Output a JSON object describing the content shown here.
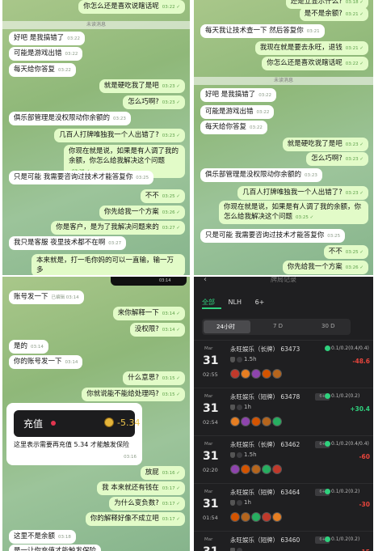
{
  "panel1": {
    "messages": [
      {
        "text": "你怎么还是喜欢说瞎话呢",
        "time": "03:22",
        "dir": "out"
      },
      {
        "divider": "未读消息"
      },
      {
        "text": "好吧 是我搞错了",
        "time": "03:22",
        "dir": "in"
      },
      {
        "text": "可能是游戏出错",
        "time": "03:22",
        "dir": "in"
      },
      {
        "text": "每天给你答复",
        "time": "03:22",
        "dir": "in"
      },
      {
        "text": "就是硬吃我了是吧",
        "time": "03:23",
        "dir": "out"
      },
      {
        "text": "怎么巧啊?",
        "time": "03:23",
        "dir": "out"
      },
      {
        "text": "俱乐部管理是没权限动你余额的",
        "time": "03:23",
        "dir": "in"
      },
      {
        "text": "几百人打牌唯独我一个人出错了?",
        "time": "03:23",
        "dir": "out"
      },
      {
        "text": "你现在就是说，如果是有人调了我的余额，你怎么给我解决这个问题",
        "time": "03:25",
        "dir": "out"
      },
      {
        "text": "只是可能  我需要咨询过技术才能答复你",
        "time": "03:25",
        "dir": "in"
      },
      {
        "text": "不不",
        "time": "03:25",
        "dir": "out"
      },
      {
        "text": "你先给我一个方案",
        "time": "03:26",
        "dir": "out"
      },
      {
        "text": "你是客户，是为了我解决问题来的",
        "time": "03:27",
        "dir": "out"
      },
      {
        "text": "我只是客服 夜里技术都不在啊",
        "time": "03:27",
        "dir": "in"
      },
      {
        "text": "本来就是，打一毛你妈的可以一直输，输一万多",
        "time": "",
        "dir": "out"
      }
    ]
  },
  "panel2": {
    "messages": [
      {
        "text": "还是立显示什么?",
        "time": "03:18",
        "dir": "out"
      },
      {
        "text": "是不是余额?",
        "time": "03:21",
        "dir": "out"
      },
      {
        "text": "每天我让技术查一下 然后答复你",
        "time": "03:21",
        "dir": "in"
      },
      {
        "text": "我现在就是要去永旺，退钱",
        "time": "03:21",
        "dir": "out"
      },
      {
        "text": "你怎么还是喜欢说瞎话呢",
        "time": "03:22",
        "dir": "out"
      },
      {
        "divider": "未读消息"
      },
      {
        "text": "好吧 是我搞错了",
        "time": "03:22",
        "dir": "in"
      },
      {
        "text": "可能是游戏出错",
        "time": "03:22",
        "dir": "in"
      },
      {
        "text": "每天给你答复",
        "time": "03:22",
        "dir": "in"
      },
      {
        "text": "就是硬吃我了是吧",
        "time": "03:23",
        "dir": "out"
      },
      {
        "text": "怎么巧啊?",
        "time": "03:23",
        "dir": "out"
      },
      {
        "text": "俱乐部管理是没权限动你余额的",
        "time": "03:23",
        "dir": "in"
      },
      {
        "text": "几百人打牌唯独我一个人出错了?",
        "time": "03:23",
        "dir": "out"
      },
      {
        "text": "你现在就是说，如果是有人调了我的余额，你怎么给我解决这个问题",
        "time": "03:25",
        "dir": "out"
      },
      {
        "text": "只是可能  我需要咨询过技术才能答复你",
        "time": "03:25",
        "dir": "in"
      },
      {
        "text": "不不",
        "time": "03:25",
        "dir": "out"
      },
      {
        "text": "你先给我一个方案",
        "time": "03:26",
        "dir": "out"
      }
    ]
  },
  "panel3": {
    "status_time": "03:14",
    "messages": [
      {
        "text": "账号发一下",
        "time": "已编辑 03:14",
        "dir": "in"
      },
      {
        "text": "来你解释一下",
        "time": "03:14",
        "dir": "out"
      },
      {
        "text": "没权限?",
        "time": "03:14",
        "dir": "out"
      },
      {
        "text": "是的",
        "time": "03:14",
        "dir": "in"
      },
      {
        "text": "你的账号发一下",
        "time": "03:14",
        "dir": "in"
      },
      {
        "text": "什么意思?",
        "time": "03:15",
        "dir": "out"
      },
      {
        "text": "你就说能不能给处理吗?",
        "time": "03:15",
        "dir": "out"
      },
      {
        "text": "放屁",
        "time": "03:16",
        "dir": "out"
      },
      {
        "text": "我 本来就还有钱在",
        "time": "03:17",
        "dir": "out"
      },
      {
        "text": "为什么变负数?",
        "time": "03:17",
        "dir": "out"
      },
      {
        "text": "你的解释好像不成立吧",
        "time": "03:17",
        "dir": "out"
      },
      {
        "text": "这里不是余额",
        "time": "03:18",
        "dir": "in"
      },
      {
        "text": "是一让你充值才能触发保险",
        "time": "",
        "dir": "in"
      }
    ],
    "recharge_card": {
      "label": "充值",
      "amount": "-5.34",
      "text": "这里表示需要再充值 5.34 才能触发保险",
      "time": "03:16"
    }
  },
  "panel4": {
    "title": "牌局记录",
    "back_icon": "‹",
    "tabs": [
      "全部",
      "NLH",
      "6+"
    ],
    "segments": [
      "24小时",
      "7 D",
      "30 D"
    ],
    "records": [
      {
        "month": "Mar",
        "day": "31",
        "time": "02:55",
        "name": "永旺娱乐（长牌）",
        "id": "63473",
        "tag": "",
        "blinds": "0.1/0.2(0.4/0.4)",
        "duration": "1.5h",
        "result": "-48.6",
        "color": "#e8453c"
      },
      {
        "month": "Mar",
        "day": "31",
        "time": "02:54",
        "name": "永旺娱乐（短牌）",
        "id": "63478",
        "tag": "6+",
        "blinds": "0.1/0.2(0.2)",
        "duration": "1h",
        "result": "+30.4",
        "color": "#2fd07d"
      },
      {
        "month": "Mar",
        "day": "31",
        "time": "02:20",
        "name": "永旺娱乐（长牌）",
        "id": "63462",
        "tag": "6+",
        "blinds": "0.1/0.2(0.4/0.4)",
        "duration": "1.5h",
        "result": "-60",
        "color": "#e8453c"
      },
      {
        "month": "Mar",
        "day": "31",
        "time": "01:54",
        "name": "永旺娱乐（短牌）",
        "id": "63464",
        "tag": "6+",
        "blinds": "0.1/0.2(0.2)",
        "duration": "1h",
        "result": "-30",
        "color": "#e8453c"
      },
      {
        "month": "Mar",
        "day": "31",
        "time": "",
        "name": "永旺娱乐（短牌）",
        "id": "63460",
        "tag": "6+",
        "blinds": "0.1/0.2(0.2)",
        "duration": "",
        "result": "-15",
        "color": "#e8453c"
      }
    ]
  }
}
